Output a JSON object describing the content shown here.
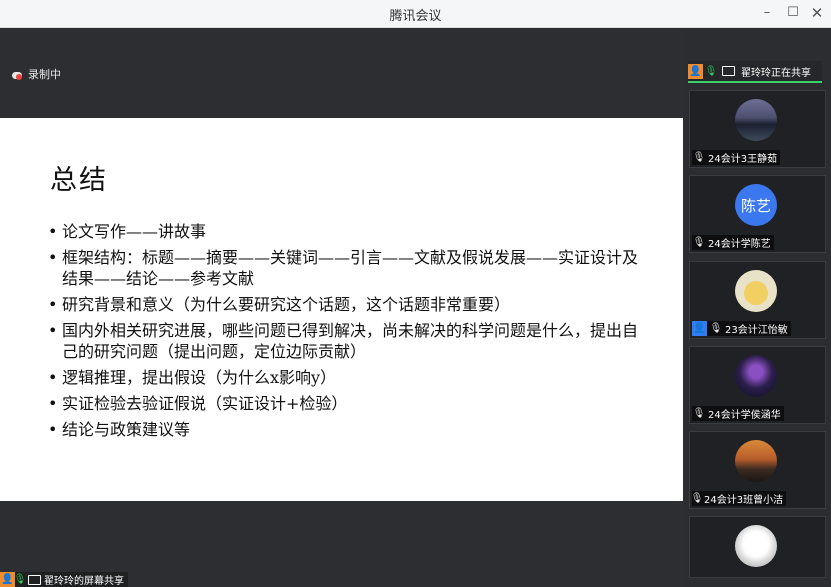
{
  "window": {
    "title": "腾讯会议",
    "minimize": "–",
    "maximize": "☐",
    "close": "✕"
  },
  "recording": {
    "label": "录制中"
  },
  "slide": {
    "title": "总结",
    "bullets": [
      "论文写作——讲故事",
      "框架结构：标题——摘要——关键词——引言——文献及假说发展——实证设计及结果——结论——参考文献",
      "研究背景和意义（为什么要研究这个话题，这个话题非常重要）",
      "国内外相关研究进展，哪些问题已得到解决，尚未解决的科学问题是什么，提出自己的研究问题（提出问题，定位边际贡献）",
      "逻辑推理，提出假设（为什么x影响y）",
      "实证检验去验证假说（实证设计+检验）",
      "结论与政策建议等"
    ]
  },
  "share_bar": {
    "label": "翟玲玲的屏幕共享"
  },
  "sidebar": {
    "sharer": {
      "label": "翟玲玲正在共享"
    },
    "participants": [
      {
        "name": "24会计3王静茹",
        "avatar_kind": "photo-lake"
      },
      {
        "name": "24会计学陈艺",
        "avatar_kind": "text",
        "avatar_text": "陈艺"
      },
      {
        "name": "23会计江怡敏",
        "avatar_kind": "photo-cartoon"
      },
      {
        "name": "24会计学侯涵华",
        "avatar_kind": "photo-night"
      },
      {
        "name": "24会计3班曾小洁",
        "avatar_kind": "photo-sunset"
      },
      {
        "name": "",
        "avatar_kind": "photo-dog"
      }
    ]
  },
  "colors": {
    "accent_green": "#3ad06b",
    "mic_green": "#2fc85a",
    "avatar_blue": "#2f7cf6",
    "host_orange": "#f08c2b",
    "record_red": "#e6463c"
  }
}
